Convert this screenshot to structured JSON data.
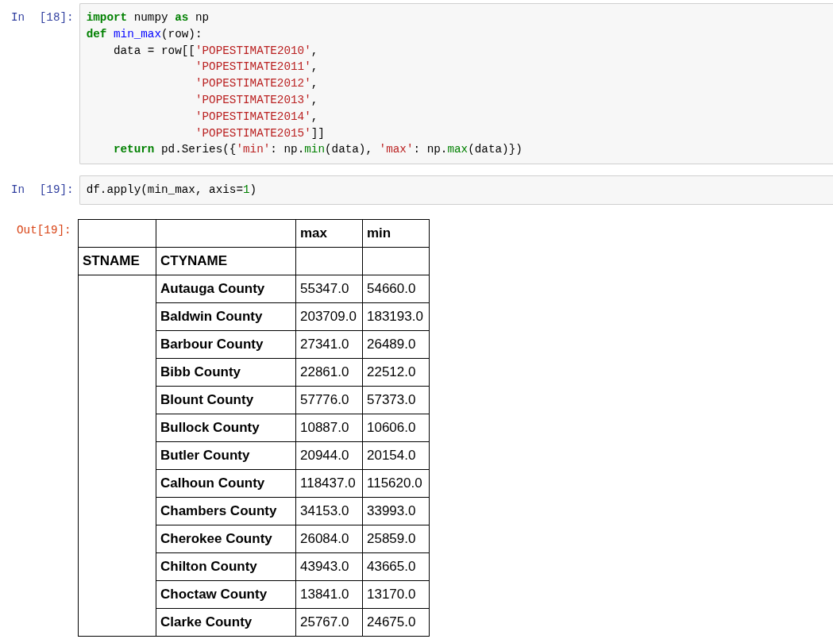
{
  "cells": [
    {
      "kind": "code",
      "prompt": "In [18]:",
      "lines": [
        [
          {
            "kind": "kw",
            "text": "import"
          },
          {
            "kind": "plain",
            "text": " numpy "
          },
          {
            "kind": "kw",
            "text": "as"
          },
          {
            "kind": "plain",
            "text": " np"
          }
        ],
        [
          {
            "kind": "kw",
            "text": "def"
          },
          {
            "kind": "fn",
            "text": " min_max"
          },
          {
            "kind": "plain",
            "text": "(row):"
          }
        ],
        [
          {
            "kind": "plain",
            "text": "    data = row[["
          },
          {
            "kind": "str",
            "text": "'POPESTIMATE2010'"
          },
          {
            "kind": "plain",
            "text": ","
          }
        ],
        [
          {
            "kind": "str",
            "text": "                'POPESTIMATE2011'"
          },
          {
            "kind": "plain",
            "text": ","
          }
        ],
        [
          {
            "kind": "str",
            "text": "                'POPESTIMATE2012'"
          },
          {
            "kind": "plain",
            "text": ","
          }
        ],
        [
          {
            "kind": "str",
            "text": "                'POPESTIMATE2013'"
          },
          {
            "kind": "plain",
            "text": ","
          }
        ],
        [
          {
            "kind": "str",
            "text": "                'POPESTIMATE2014'"
          },
          {
            "kind": "plain",
            "text": ","
          }
        ],
        [
          {
            "kind": "str",
            "text": "                'POPESTIMATE2015'"
          },
          {
            "kind": "plain",
            "text": "]]"
          }
        ],
        [
          {
            "kind": "kw",
            "text": "    return"
          },
          {
            "kind": "plain",
            "text": " pd.Series({"
          },
          {
            "kind": "str",
            "text": "'min'"
          },
          {
            "kind": "plain",
            "text": ": np."
          },
          {
            "kind": "builtin",
            "text": "min"
          },
          {
            "kind": "plain",
            "text": "(data), "
          },
          {
            "kind": "str",
            "text": "'max'"
          },
          {
            "kind": "plain",
            "text": ": np."
          },
          {
            "kind": "builtin",
            "text": "max"
          },
          {
            "kind": "plain",
            "text": "(data)})"
          }
        ]
      ]
    },
    {
      "kind": "code",
      "prompt": "In [19]:",
      "lines": [
        [
          {
            "kind": "plain",
            "text": "df.apply(min_max, axis="
          },
          {
            "kind": "num",
            "text": "1"
          },
          {
            "kind": "plain",
            "text": ")"
          }
        ]
      ]
    },
    {
      "kind": "output",
      "prompt": "Out[19]:",
      "table": {
        "columns": [
          "max",
          "min"
        ],
        "index_names": [
          "STNAME",
          "CTYNAME"
        ],
        "rows": [
          {
            "label": "Autauga County",
            "values": [
              "55347.0",
              "54660.0"
            ]
          },
          {
            "label": "Baldwin County",
            "values": [
              "203709.0",
              "183193.0"
            ]
          },
          {
            "label": "Barbour County",
            "values": [
              "27341.0",
              "26489.0"
            ]
          },
          {
            "label": "Bibb County",
            "values": [
              "22861.0",
              "22512.0"
            ]
          },
          {
            "label": "Blount County",
            "values": [
              "57776.0",
              "57373.0"
            ]
          },
          {
            "label": "Bullock County",
            "values": [
              "10887.0",
              "10606.0"
            ]
          },
          {
            "label": "Butler County",
            "values": [
              "20944.0",
              "20154.0"
            ]
          },
          {
            "label": "Calhoun County",
            "values": [
              "118437.0",
              "115620.0"
            ]
          },
          {
            "label": "Chambers County",
            "values": [
              "34153.0",
              "33993.0"
            ]
          },
          {
            "label": "Cherokee County",
            "values": [
              "26084.0",
              "25859.0"
            ]
          },
          {
            "label": "Chilton County",
            "values": [
              "43943.0",
              "43665.0"
            ]
          },
          {
            "label": "Choctaw County",
            "values": [
              "13841.0",
              "13170.0"
            ]
          },
          {
            "label": "Clarke County",
            "values": [
              "25767.0",
              "24675.0"
            ]
          }
        ]
      }
    }
  ]
}
